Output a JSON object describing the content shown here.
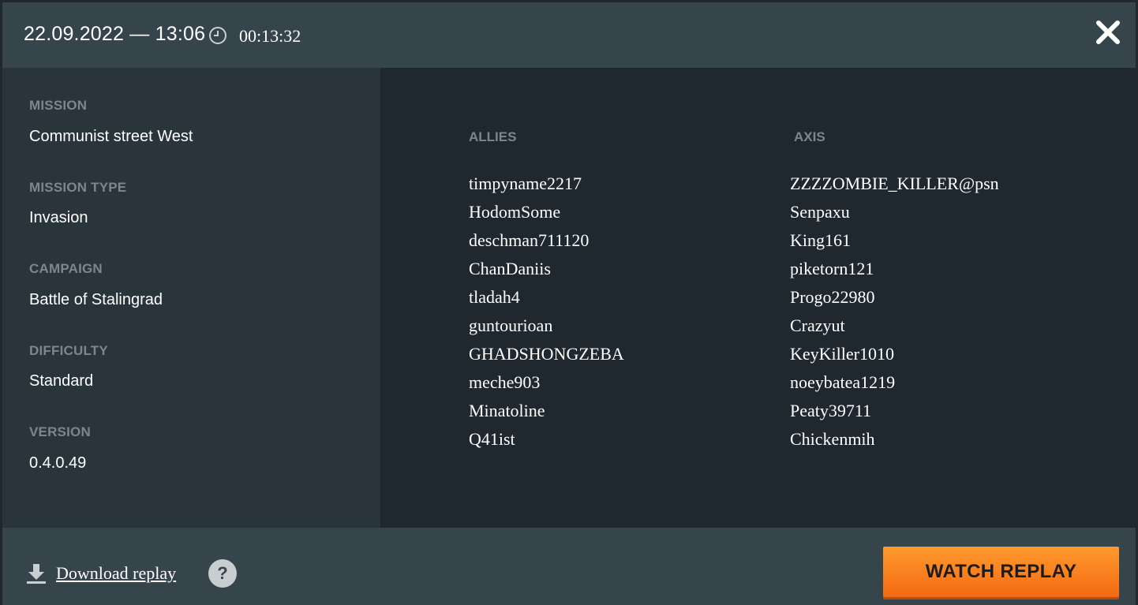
{
  "header": {
    "date": "22.09.2022 — 13:06",
    "duration": "00:13:32"
  },
  "info": {
    "mission_label": "MISSION",
    "mission_value": "Communist street West",
    "mission_type_label": "MISSION TYPE",
    "mission_type_value": "Invasion",
    "campaign_label": "CAMPAIGN",
    "campaign_value": "Battle of Stalingrad",
    "difficulty_label": "DIFFICULTY",
    "difficulty_value": "Standard",
    "version_label": "VERSION",
    "version_value": "0.4.0.49"
  },
  "teams": {
    "allies": {
      "title": "ALLIES",
      "players": [
        "timpyname2217",
        "HodomSome",
        "deschman711120",
        "ChanDaniis",
        "tladah4",
        "guntourioan",
        "GHADSHONGZEBA",
        "meche903",
        "Minatoline",
        "Q41ist"
      ]
    },
    "axis": {
      "title": "AXIS",
      "players": [
        "ZZZZOMBIE_KILLER@psn",
        "Senpaxu",
        "King161",
        "piketorn121",
        "Progo22980",
        "Crazyut",
        "KeyKiller1010",
        "noeybatea1219",
        "Peaty39711",
        "Chickenmih"
      ]
    }
  },
  "footer": {
    "download_label": "Download replay",
    "help_label": "?",
    "watch_label": "WATCH REPLAY"
  },
  "colors": {
    "accent": "#f5801e",
    "header_bg": "#36444b",
    "muted_label": "#7b878d"
  },
  "icons": {
    "clock": "clock-icon",
    "close": "close-icon",
    "download": "download-icon",
    "help": "help-icon"
  }
}
